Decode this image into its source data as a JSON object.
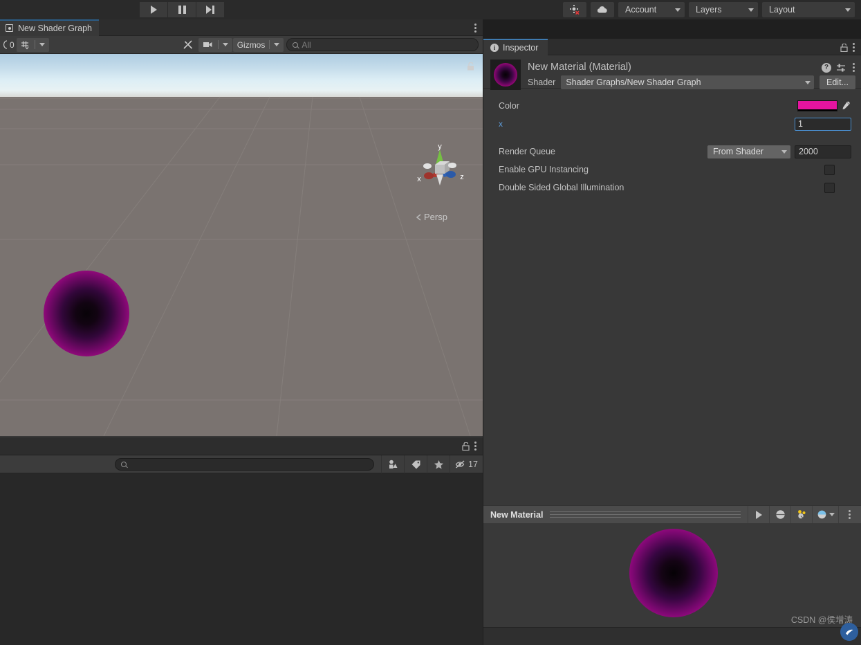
{
  "toolbar": {
    "play_label": "play-icon",
    "pause_label": "pause-icon",
    "step_label": "step-icon",
    "collab_label": "cloud-icon",
    "account_label": "Account",
    "layers_label": "Layers",
    "layout_label": "Layout"
  },
  "scene": {
    "tab_label": "New Shader Graph",
    "toolbar": {
      "shaded_count": "0",
      "grid_label": "grid-icon",
      "tools_label": "tools-icon",
      "camera_label": "camera-icon",
      "gizmos_label": "Gizmos",
      "search_placeholder": "All"
    },
    "gizmo": {
      "x": "x",
      "y": "y",
      "z": "z",
      "persp": "Persp"
    },
    "sky_top_color": "#aecce1",
    "ground_color": "#7a7370",
    "sphere_edge_color": "#e014a6"
  },
  "project": {
    "search_placeholder": "",
    "visible_count": "17"
  },
  "inspector": {
    "tab_label": "Inspector",
    "material_title": "New Material (Material)",
    "shader_label": "Shader",
    "shader_value": "Shader Graphs/New Shader Graph",
    "edit_label": "Edit...",
    "properties": {
      "color_label": "Color",
      "color_value": "#E514A0",
      "vector_x_label": "x",
      "vector_x_value": "1",
      "render_queue_label": "Render Queue",
      "render_queue_mode": "From Shader",
      "render_queue_value": "2000",
      "gpu_instancing_label": "Enable GPU Instancing",
      "gpu_instancing_checked": false,
      "double_sided_gi_label": "Double Sided Global Illumination",
      "double_sided_gi_checked": false
    },
    "preview": {
      "title": "New Material"
    }
  },
  "watermark": {
    "text": "CSDN @侯增涛"
  }
}
